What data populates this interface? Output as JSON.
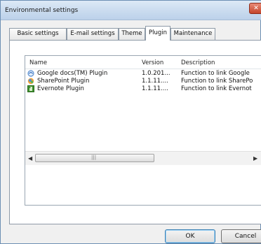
{
  "window": {
    "title": "Environmental settings",
    "close_glyph": "✕"
  },
  "tabs": [
    {
      "label": "Basic settings",
      "active": false
    },
    {
      "label": "E-mail settings",
      "active": false
    },
    {
      "label": "Theme",
      "active": false
    },
    {
      "label": "Plugin",
      "active": true
    },
    {
      "label": "Maintenance",
      "active": false
    }
  ],
  "plugin_list": {
    "columns": [
      "Name",
      "Version",
      "Description"
    ],
    "rows": [
      {
        "name": "Google docs(TM) Plugin",
        "version": "1.0.201...",
        "description": "Function to link Google",
        "icon": "google-docs-icon"
      },
      {
        "name": "SharePoint Plugin",
        "version": "1.1.11....",
        "description": "Function to link SharePo",
        "icon": "sharepoint-icon"
      },
      {
        "name": "Evernote Plugin",
        "version": "1.1.11....",
        "description": "Function to link Evernot",
        "icon": "evernote-icon"
      }
    ]
  },
  "scrollbar": {
    "left_arrow": "◀",
    "right_arrow": "▶",
    "grip": "|||"
  },
  "buttons": {
    "ok": "OK",
    "cancel": "Cancel"
  }
}
